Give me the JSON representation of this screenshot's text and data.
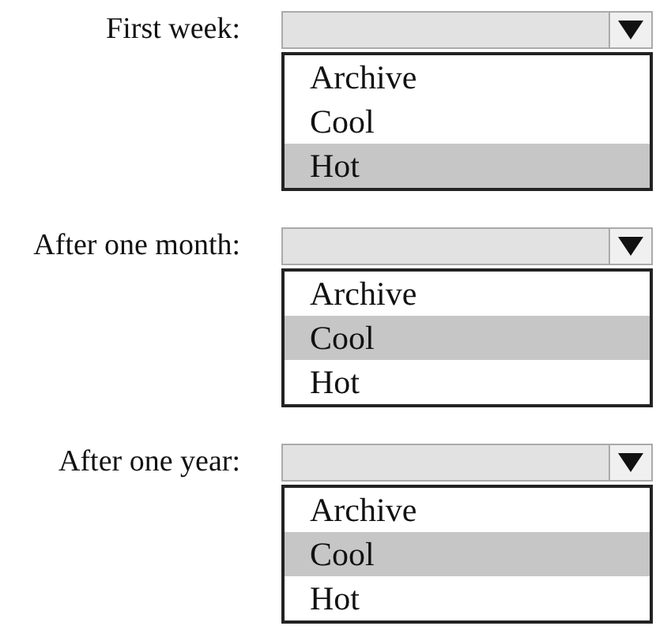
{
  "groups": [
    {
      "label": "First week:",
      "items": [
        {
          "label": "Archive",
          "selected": false
        },
        {
          "label": "Cool",
          "selected": false
        },
        {
          "label": "Hot",
          "selected": true
        }
      ]
    },
    {
      "label": "After one month:",
      "items": [
        {
          "label": "Archive",
          "selected": false
        },
        {
          "label": "Cool",
          "selected": true
        },
        {
          "label": "Hot",
          "selected": false
        }
      ]
    },
    {
      "label": "After one year:",
      "items": [
        {
          "label": "Archive",
          "selected": false
        },
        {
          "label": "Cool",
          "selected": true
        },
        {
          "label": "Hot",
          "selected": false
        }
      ]
    }
  ]
}
